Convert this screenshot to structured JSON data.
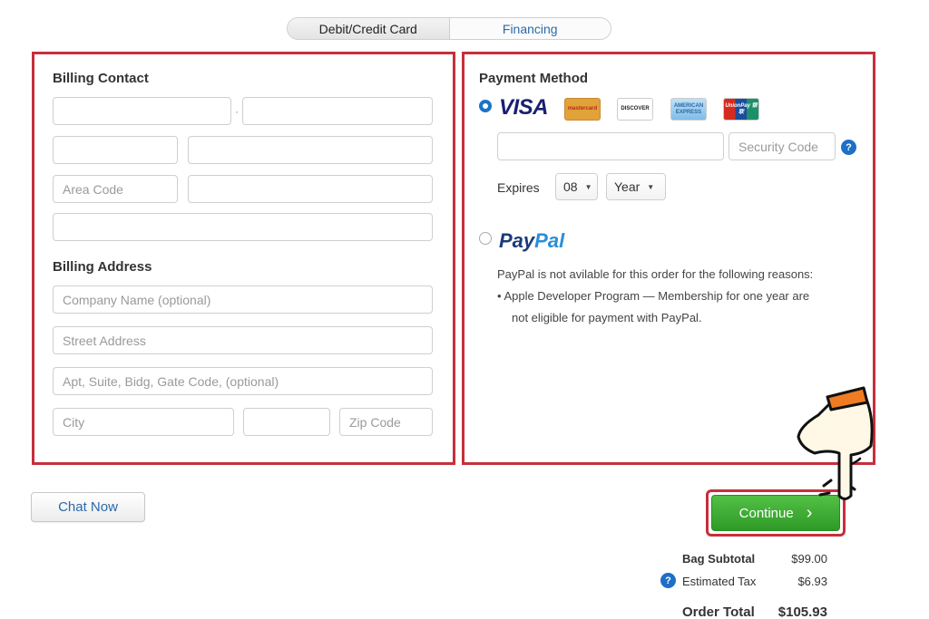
{
  "tabs": {
    "card_label": "Debit/Credit Card",
    "financing_label": "Financing"
  },
  "billing_contact": {
    "title": "Billing Contact",
    "first_name_sep": "·",
    "area_code_placeholder": "Area Code"
  },
  "billing_address": {
    "title": "Billing Address",
    "company_placeholder": "Company Name   (optional)",
    "street_placeholder": "Street Address",
    "apt_placeholder": "Apt, Suite, Bidg, Gate Code, (optional)",
    "city_placeholder": "City",
    "zip_placeholder": "Zip Code"
  },
  "payment": {
    "title": "Payment Method",
    "visa_label": "VISA",
    "cards": {
      "mastercard": "mastercard",
      "discover": "DISCOVER",
      "amex": "AMERICAN EXPRESS",
      "unionpay": "UnionPay 银联"
    },
    "security_placeholder": "Security Code",
    "help_glyph": "?",
    "expires_label": "Expires",
    "month_value": "08",
    "year_value": "Year",
    "paypal_pay": "Pay",
    "paypal_pal": "Pal",
    "paypal_note": "PayPal is not avilable for this order for the following reasons:",
    "paypal_reason_1": "•  Apple Developer Program — Membership for one year are",
    "paypal_reason_2": "not eligible for payment with PayPal."
  },
  "actions": {
    "chat_label": "Chat Now",
    "continue_label": "Continue",
    "continue_arrow": "›"
  },
  "summary": {
    "subtotal_label": "Bag Subtotal",
    "subtotal_value": "$99.00",
    "tax_label": "Estimated Tax",
    "tax_value": "$6.93",
    "total_label": "Order Total",
    "total_value": "$105.93"
  },
  "colors": {
    "highlight": "#c62f3b",
    "accent_blue": "#1e6fc6",
    "continue_green": "#3caf33"
  },
  "icons": {
    "pointer": "pointing-hand-icon",
    "help": "question-icon",
    "chevron": "chevron-right-icon"
  }
}
